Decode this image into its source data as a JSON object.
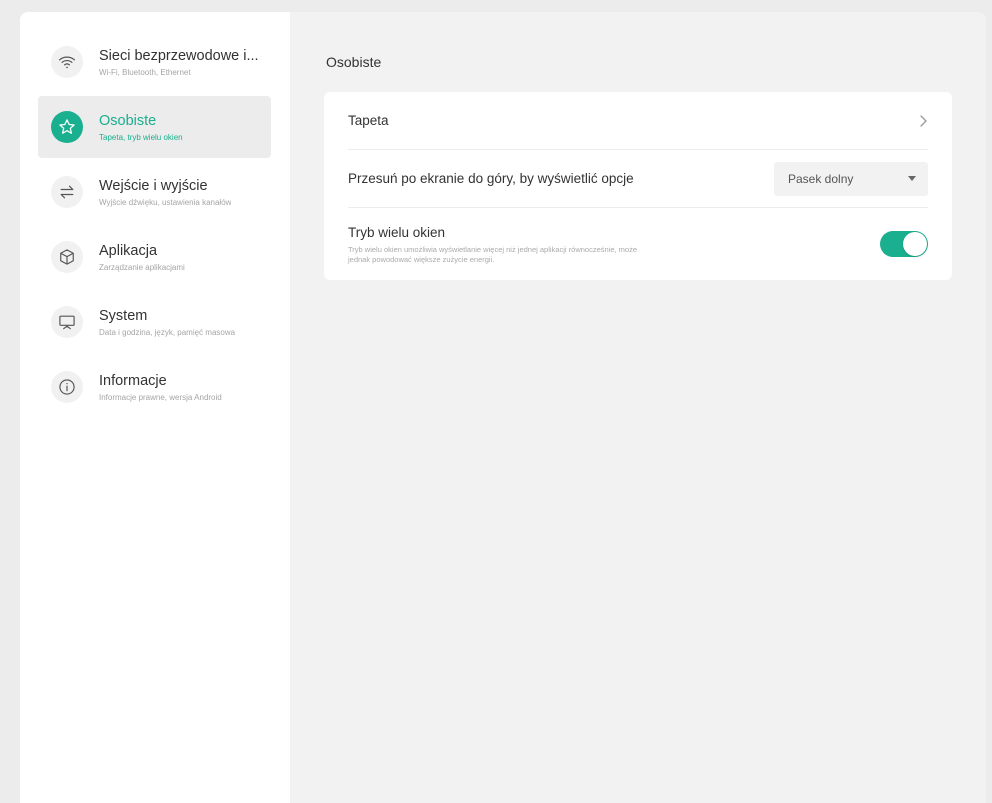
{
  "sidebar": {
    "items": [
      {
        "title": "Sieci bezprzewodowe i...",
        "subtitle": "Wi-Fi, Bluetooth, Ethernet",
        "icon": "wifi-icon",
        "active": false
      },
      {
        "title": "Osobiste",
        "subtitle": "Tapeta, tryb wielu okien",
        "icon": "star-icon",
        "active": true
      },
      {
        "title": "Wejście i wyjście",
        "subtitle": "Wyjście dźwięku, ustawienia kanałów",
        "icon": "swap-arrows-icon",
        "active": false
      },
      {
        "title": "Aplikacja",
        "subtitle": "Zarządzanie aplikacjami",
        "icon": "cube-icon",
        "active": false
      },
      {
        "title": "System",
        "subtitle": "Data i godzina, język, pamięć masowa",
        "icon": "monitor-icon",
        "active": false
      },
      {
        "title": "Informacje",
        "subtitle": "Informacje prawne, wersja Android",
        "icon": "info-icon",
        "active": false
      }
    ]
  },
  "main": {
    "title": "Osobiste",
    "wallpaper_label": "Tapeta",
    "swipe_label": "Przesuń po ekranie do góry, by wyświetlić opcje",
    "swipe_value": "Pasek dolny",
    "multiwindow_label": "Tryb wielu okien",
    "multiwindow_desc": "Tryb wielu okien umożliwia wyświetlanie więcej niż jednej aplikacji równocześnie, może jednak powodować większe zużycie energii.",
    "multiwindow_enabled": true
  },
  "colors": {
    "accent": "#1aaf8e",
    "sidebar_bg": "#ffffff",
    "content_bg": "#f2f2f2",
    "active_item_bg": "#ececec"
  }
}
